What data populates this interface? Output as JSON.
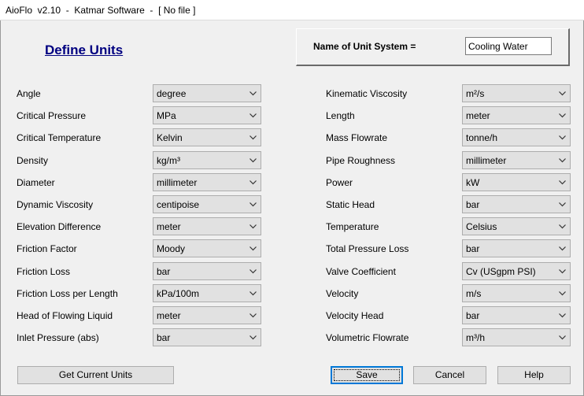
{
  "window": {
    "title": "AioFlo  v2.10  -  Katmar Software  -  [ No file ]"
  },
  "heading": "Define Units",
  "unit_system": {
    "label": "Name of Unit System =",
    "value": "Cooling Water"
  },
  "left_units": [
    {
      "label": "Angle",
      "value": "degree"
    },
    {
      "label": "Critical Pressure",
      "value": "MPa"
    },
    {
      "label": "Critical Temperature",
      "value": "Kelvin"
    },
    {
      "label": "Density",
      "value": "kg/m³"
    },
    {
      "label": "Diameter",
      "value": "millimeter"
    },
    {
      "label": "Dynamic Viscosity",
      "value": "centipoise"
    },
    {
      "label": "Elevation Difference",
      "value": "meter"
    },
    {
      "label": "Friction Factor",
      "value": "Moody"
    },
    {
      "label": "Friction Loss",
      "value": "bar"
    },
    {
      "label": "Friction Loss per Length",
      "value": "kPa/100m"
    },
    {
      "label": "Head of Flowing Liquid",
      "value": "meter"
    },
    {
      "label": "Inlet Pressure (abs)",
      "value": "bar"
    }
  ],
  "right_units": [
    {
      "label": "Kinematic Viscosity",
      "value": "m²/s"
    },
    {
      "label": "Length",
      "value": "meter"
    },
    {
      "label": "Mass Flowrate",
      "value": "tonne/h"
    },
    {
      "label": "Pipe Roughness",
      "value": "millimeter"
    },
    {
      "label": "Power",
      "value": "kW"
    },
    {
      "label": "Static Head",
      "value": "bar"
    },
    {
      "label": "Temperature",
      "value": "Celsius"
    },
    {
      "label": "Total Pressure Loss",
      "value": "bar"
    },
    {
      "label": "Valve Coefficient",
      "value": "Cv (USgpm PSI)"
    },
    {
      "label": "Velocity",
      "value": "m/s"
    },
    {
      "label": "Velocity Head",
      "value": "bar"
    },
    {
      "label": "Volumetric Flowrate",
      "value": "m³/h"
    }
  ],
  "buttons": {
    "get_current_units": "Get Current Units",
    "save": "Save",
    "cancel": "Cancel",
    "help": "Help"
  },
  "icons": {
    "dropdown": "chevron-down-icon"
  }
}
